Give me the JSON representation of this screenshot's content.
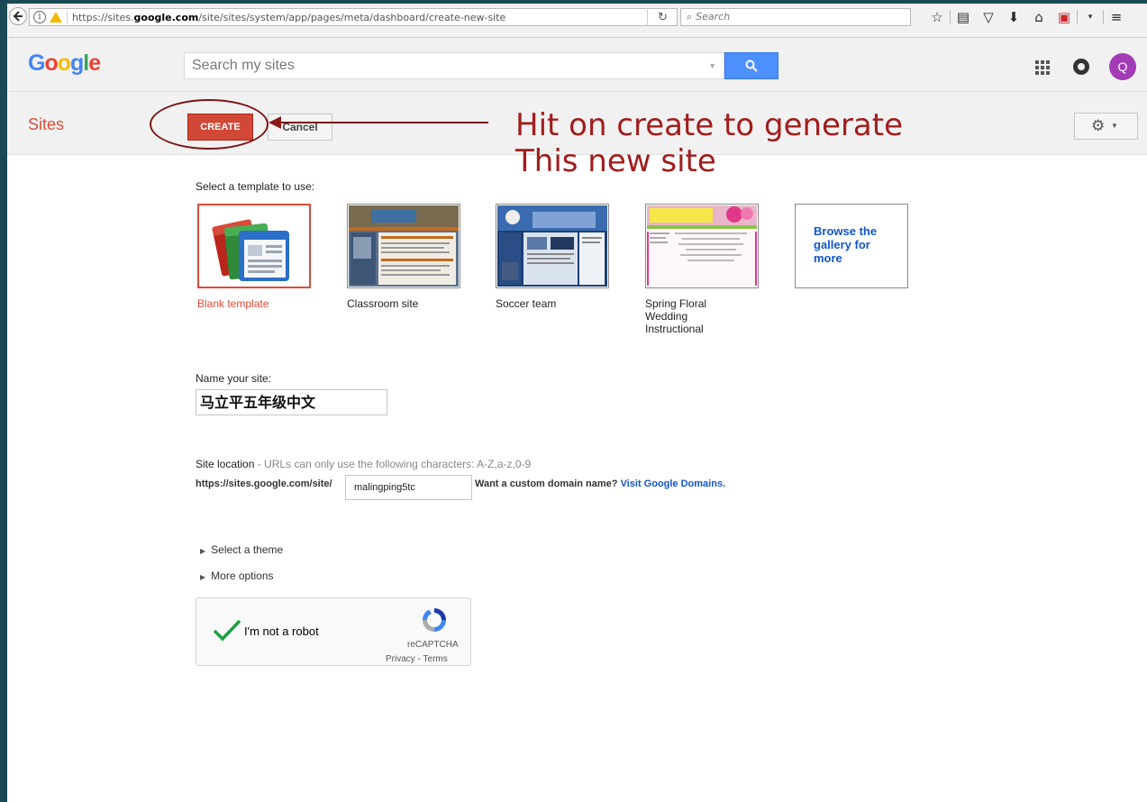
{
  "browser": {
    "url_prefix": "https://sites.",
    "url_domain": "google.com",
    "url_path": "/site/sites/system/app/pages/meta/dashboard/create-new-site",
    "search_placeholder": "Search"
  },
  "header": {
    "logo": [
      "G",
      "o",
      "o",
      "g",
      "l",
      "e"
    ],
    "search_placeholder": "Search my sites",
    "avatar_initial": "Q"
  },
  "action_bar": {
    "title": "Sites",
    "create_label": "CREATE",
    "cancel_label": "Cancel"
  },
  "annotation": {
    "line1": "Hit on create to generate",
    "line2": "This new site"
  },
  "templates": {
    "heading": "Select a template to use:",
    "items": [
      {
        "label": "Blank template",
        "selected": true
      },
      {
        "label": "Classroom site",
        "selected": false
      },
      {
        "label": "Soccer team",
        "selected": false
      },
      {
        "label": "Spring Floral Wedding Instructional",
        "selected": false
      }
    ],
    "browse_label": "Browse the gallery for more"
  },
  "site_name": {
    "label": "Name your site:",
    "value": "马立平五年级中文"
  },
  "site_location": {
    "label": "Site location",
    "hint": "- URLs can only use the following characters: A-Z,a-z,0-9",
    "prefix": "https://sites.google.com/site/",
    "value": "malingping5tc",
    "custom_question": "Want a custom domain name?",
    "custom_link": "Visit Google Domains."
  },
  "options": {
    "theme": "Select a theme",
    "more": "More options"
  },
  "recaptcha": {
    "label": "I'm not a robot",
    "brand": "reCAPTCHA",
    "privacy": "Privacy",
    "terms": "Terms"
  },
  "colors": {
    "create_red": "#d14836",
    "annotation": "#a11d1d",
    "link_blue": "#1155cc",
    "search_blue": "#4d90fe"
  }
}
